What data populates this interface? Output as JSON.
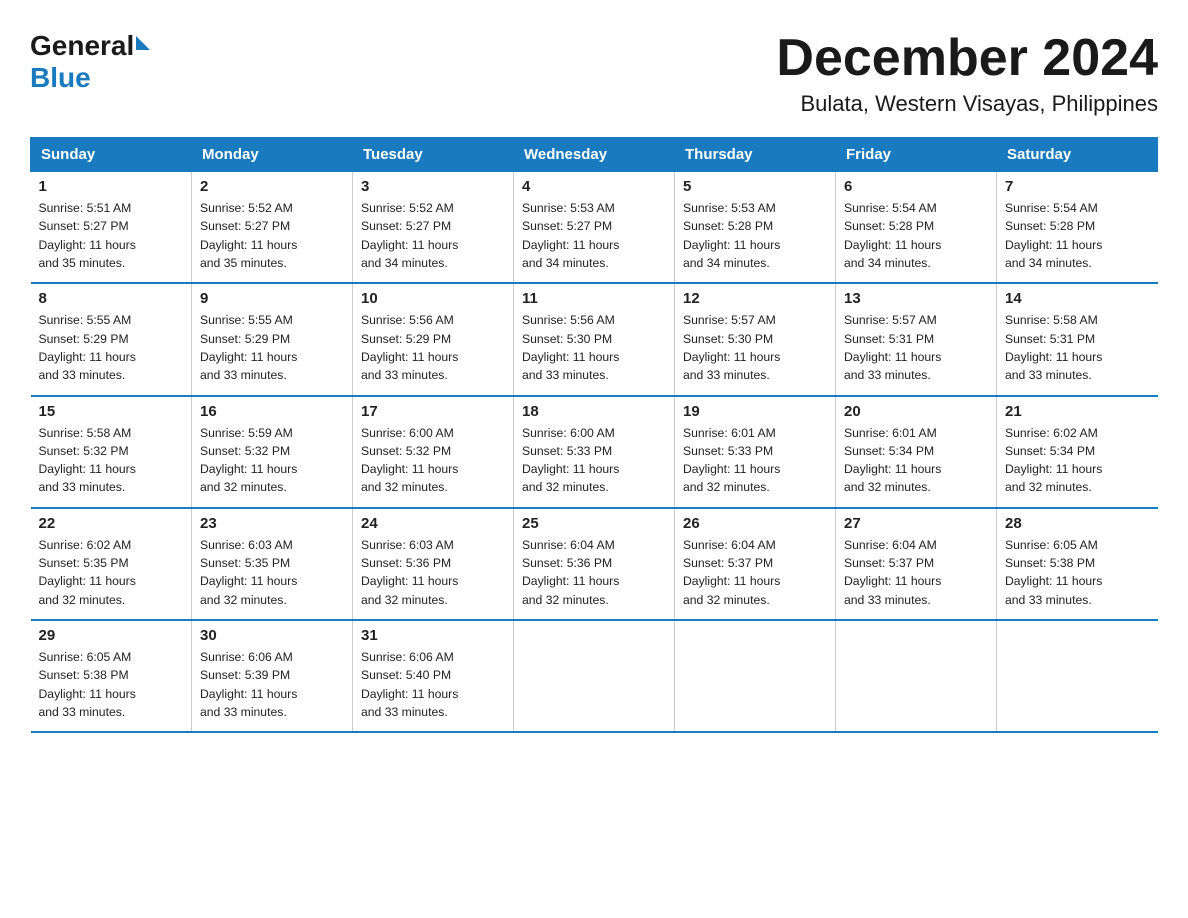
{
  "logo": {
    "general": "General",
    "blue": "Blue"
  },
  "title": "December 2024",
  "subtitle": "Bulata, Western Visayas, Philippines",
  "days_of_week": [
    "Sunday",
    "Monday",
    "Tuesday",
    "Wednesday",
    "Thursday",
    "Friday",
    "Saturday"
  ],
  "weeks": [
    [
      {
        "day": "1",
        "info": "Sunrise: 5:51 AM\nSunset: 5:27 PM\nDaylight: 11 hours\nand 35 minutes."
      },
      {
        "day": "2",
        "info": "Sunrise: 5:52 AM\nSunset: 5:27 PM\nDaylight: 11 hours\nand 35 minutes."
      },
      {
        "day": "3",
        "info": "Sunrise: 5:52 AM\nSunset: 5:27 PM\nDaylight: 11 hours\nand 34 minutes."
      },
      {
        "day": "4",
        "info": "Sunrise: 5:53 AM\nSunset: 5:27 PM\nDaylight: 11 hours\nand 34 minutes."
      },
      {
        "day": "5",
        "info": "Sunrise: 5:53 AM\nSunset: 5:28 PM\nDaylight: 11 hours\nand 34 minutes."
      },
      {
        "day": "6",
        "info": "Sunrise: 5:54 AM\nSunset: 5:28 PM\nDaylight: 11 hours\nand 34 minutes."
      },
      {
        "day": "7",
        "info": "Sunrise: 5:54 AM\nSunset: 5:28 PM\nDaylight: 11 hours\nand 34 minutes."
      }
    ],
    [
      {
        "day": "8",
        "info": "Sunrise: 5:55 AM\nSunset: 5:29 PM\nDaylight: 11 hours\nand 33 minutes."
      },
      {
        "day": "9",
        "info": "Sunrise: 5:55 AM\nSunset: 5:29 PM\nDaylight: 11 hours\nand 33 minutes."
      },
      {
        "day": "10",
        "info": "Sunrise: 5:56 AM\nSunset: 5:29 PM\nDaylight: 11 hours\nand 33 minutes."
      },
      {
        "day": "11",
        "info": "Sunrise: 5:56 AM\nSunset: 5:30 PM\nDaylight: 11 hours\nand 33 minutes."
      },
      {
        "day": "12",
        "info": "Sunrise: 5:57 AM\nSunset: 5:30 PM\nDaylight: 11 hours\nand 33 minutes."
      },
      {
        "day": "13",
        "info": "Sunrise: 5:57 AM\nSunset: 5:31 PM\nDaylight: 11 hours\nand 33 minutes."
      },
      {
        "day": "14",
        "info": "Sunrise: 5:58 AM\nSunset: 5:31 PM\nDaylight: 11 hours\nand 33 minutes."
      }
    ],
    [
      {
        "day": "15",
        "info": "Sunrise: 5:58 AM\nSunset: 5:32 PM\nDaylight: 11 hours\nand 33 minutes."
      },
      {
        "day": "16",
        "info": "Sunrise: 5:59 AM\nSunset: 5:32 PM\nDaylight: 11 hours\nand 32 minutes."
      },
      {
        "day": "17",
        "info": "Sunrise: 6:00 AM\nSunset: 5:32 PM\nDaylight: 11 hours\nand 32 minutes."
      },
      {
        "day": "18",
        "info": "Sunrise: 6:00 AM\nSunset: 5:33 PM\nDaylight: 11 hours\nand 32 minutes."
      },
      {
        "day": "19",
        "info": "Sunrise: 6:01 AM\nSunset: 5:33 PM\nDaylight: 11 hours\nand 32 minutes."
      },
      {
        "day": "20",
        "info": "Sunrise: 6:01 AM\nSunset: 5:34 PM\nDaylight: 11 hours\nand 32 minutes."
      },
      {
        "day": "21",
        "info": "Sunrise: 6:02 AM\nSunset: 5:34 PM\nDaylight: 11 hours\nand 32 minutes."
      }
    ],
    [
      {
        "day": "22",
        "info": "Sunrise: 6:02 AM\nSunset: 5:35 PM\nDaylight: 11 hours\nand 32 minutes."
      },
      {
        "day": "23",
        "info": "Sunrise: 6:03 AM\nSunset: 5:35 PM\nDaylight: 11 hours\nand 32 minutes."
      },
      {
        "day": "24",
        "info": "Sunrise: 6:03 AM\nSunset: 5:36 PM\nDaylight: 11 hours\nand 32 minutes."
      },
      {
        "day": "25",
        "info": "Sunrise: 6:04 AM\nSunset: 5:36 PM\nDaylight: 11 hours\nand 32 minutes."
      },
      {
        "day": "26",
        "info": "Sunrise: 6:04 AM\nSunset: 5:37 PM\nDaylight: 11 hours\nand 32 minutes."
      },
      {
        "day": "27",
        "info": "Sunrise: 6:04 AM\nSunset: 5:37 PM\nDaylight: 11 hours\nand 33 minutes."
      },
      {
        "day": "28",
        "info": "Sunrise: 6:05 AM\nSunset: 5:38 PM\nDaylight: 11 hours\nand 33 minutes."
      }
    ],
    [
      {
        "day": "29",
        "info": "Sunrise: 6:05 AM\nSunset: 5:38 PM\nDaylight: 11 hours\nand 33 minutes."
      },
      {
        "day": "30",
        "info": "Sunrise: 6:06 AM\nSunset: 5:39 PM\nDaylight: 11 hours\nand 33 minutes."
      },
      {
        "day": "31",
        "info": "Sunrise: 6:06 AM\nSunset: 5:40 PM\nDaylight: 11 hours\nand 33 minutes."
      },
      null,
      null,
      null,
      null
    ]
  ]
}
